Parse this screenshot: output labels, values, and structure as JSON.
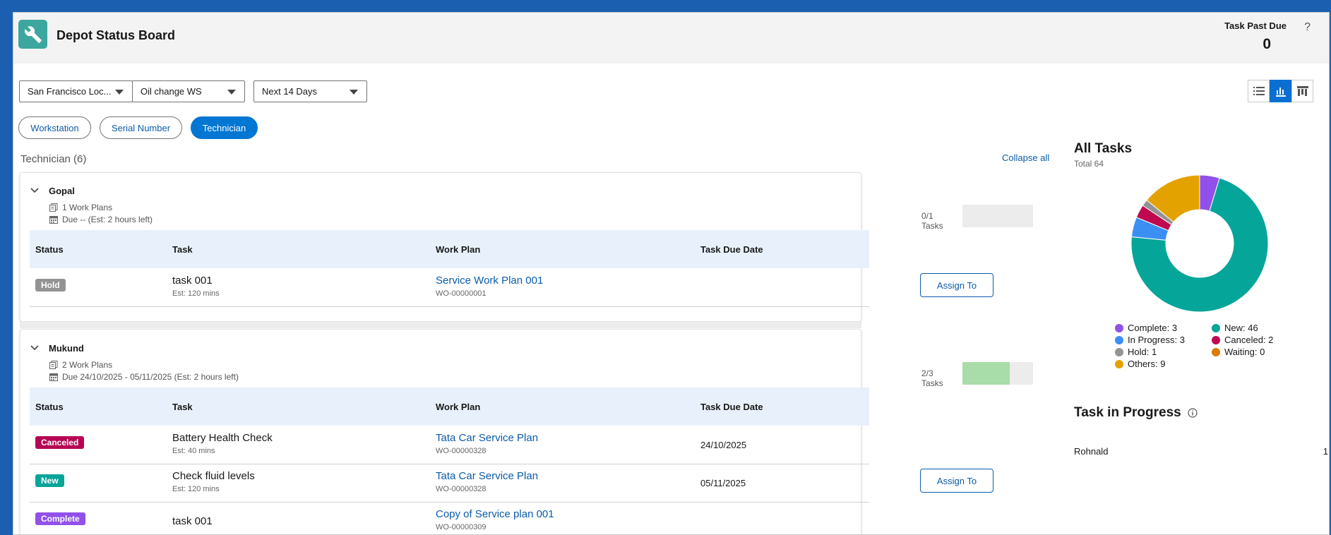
{
  "header": {
    "title": "Depot Status Board",
    "past_due_label": "Task Past Due",
    "past_due_value": "0",
    "help": "?"
  },
  "filters": {
    "location": "San Francisco Loc...",
    "workstation": "Oil change WS",
    "range": "Next 14 Days"
  },
  "group_tabs": [
    "Workstation",
    "Serial Number",
    "Technician"
  ],
  "active_group": "Technician",
  "section": {
    "title": "Technician (6)",
    "collapse_all": "Collapse all"
  },
  "table_headers": {
    "status": "Status",
    "task": "Task",
    "work_plan": "Work Plan",
    "due": "Task Due Date"
  },
  "technicians": [
    {
      "name": "Gopal",
      "work_plans": "1 Work Plans",
      "due": "Due -- (Est: 2 hours left)",
      "task_count": "0/1 Tasks",
      "progress": 0,
      "rows": [
        {
          "status": "Hold",
          "status_color": "#939393",
          "task": "task 001",
          "est": "Est: 120 mins",
          "work_plan": "Service Work Plan 001",
          "wo": "WO-00000001",
          "due_date": "",
          "assign": "Assign To"
        }
      ]
    },
    {
      "name": "Mukund",
      "work_plans": "2 Work Plans",
      "due": "Due 24/10/2025 - 05/11/2025 (Est: 2 hours left)",
      "task_count": "2/3 Tasks",
      "progress": 0.667,
      "rows": [
        {
          "status": "Canceled",
          "status_color": "#b60554",
          "task": "Battery Health Check",
          "est": "Est: 40 mins",
          "work_plan": "Tata Car Service Plan",
          "wo": "WO-00000328",
          "due_date": "24/10/2025",
          "assign": ""
        },
        {
          "status": "New",
          "status_color": "#06a59a",
          "task": "Check fluid levels",
          "est": "Est: 120 mins",
          "work_plan": "Tata Car Service Plan",
          "wo": "WO-00000328",
          "due_date": "05/11/2025",
          "assign": "Assign To"
        },
        {
          "status": "Complete",
          "status_color": "#9050e9",
          "task": "task 001",
          "est": "",
          "work_plan": "Copy of Service plan 001",
          "wo": "WO-00000309",
          "due_date": "",
          "assign": ""
        }
      ]
    }
  ],
  "all_tasks": {
    "title": "All Tasks",
    "total": "Total 64",
    "legend": [
      {
        "label": "Complete: 3",
        "color": "#9050e9"
      },
      {
        "label": "New: 46",
        "color": "#06a59a"
      },
      {
        "label": "In Progress: 3",
        "color": "#3b8ff3"
      },
      {
        "label": "Canceled: 2",
        "color": "#c0084f"
      },
      {
        "label": "Hold: 1",
        "color": "#939393"
      },
      {
        "label": "Waiting: 0",
        "color": "#dd7a01"
      },
      {
        "label": "Others: 9",
        "color": "#e4a201"
      }
    ]
  },
  "chart_data": {
    "type": "pie",
    "title": "All Tasks",
    "subtitle": "Total 64",
    "categories": [
      "Complete",
      "New",
      "In Progress",
      "Canceled",
      "Hold",
      "Waiting",
      "Others"
    ],
    "values": [
      3,
      46,
      3,
      2,
      1,
      0,
      9
    ],
    "colors": [
      "#9050e9",
      "#06a59a",
      "#3b8ff3",
      "#c0084f",
      "#939393",
      "#dd7a01",
      "#e4a201"
    ],
    "legend": "bottom"
  },
  "in_progress": {
    "title": "Task in Progress",
    "rows": [
      {
        "name": "Rohnald",
        "count": "1"
      }
    ]
  }
}
